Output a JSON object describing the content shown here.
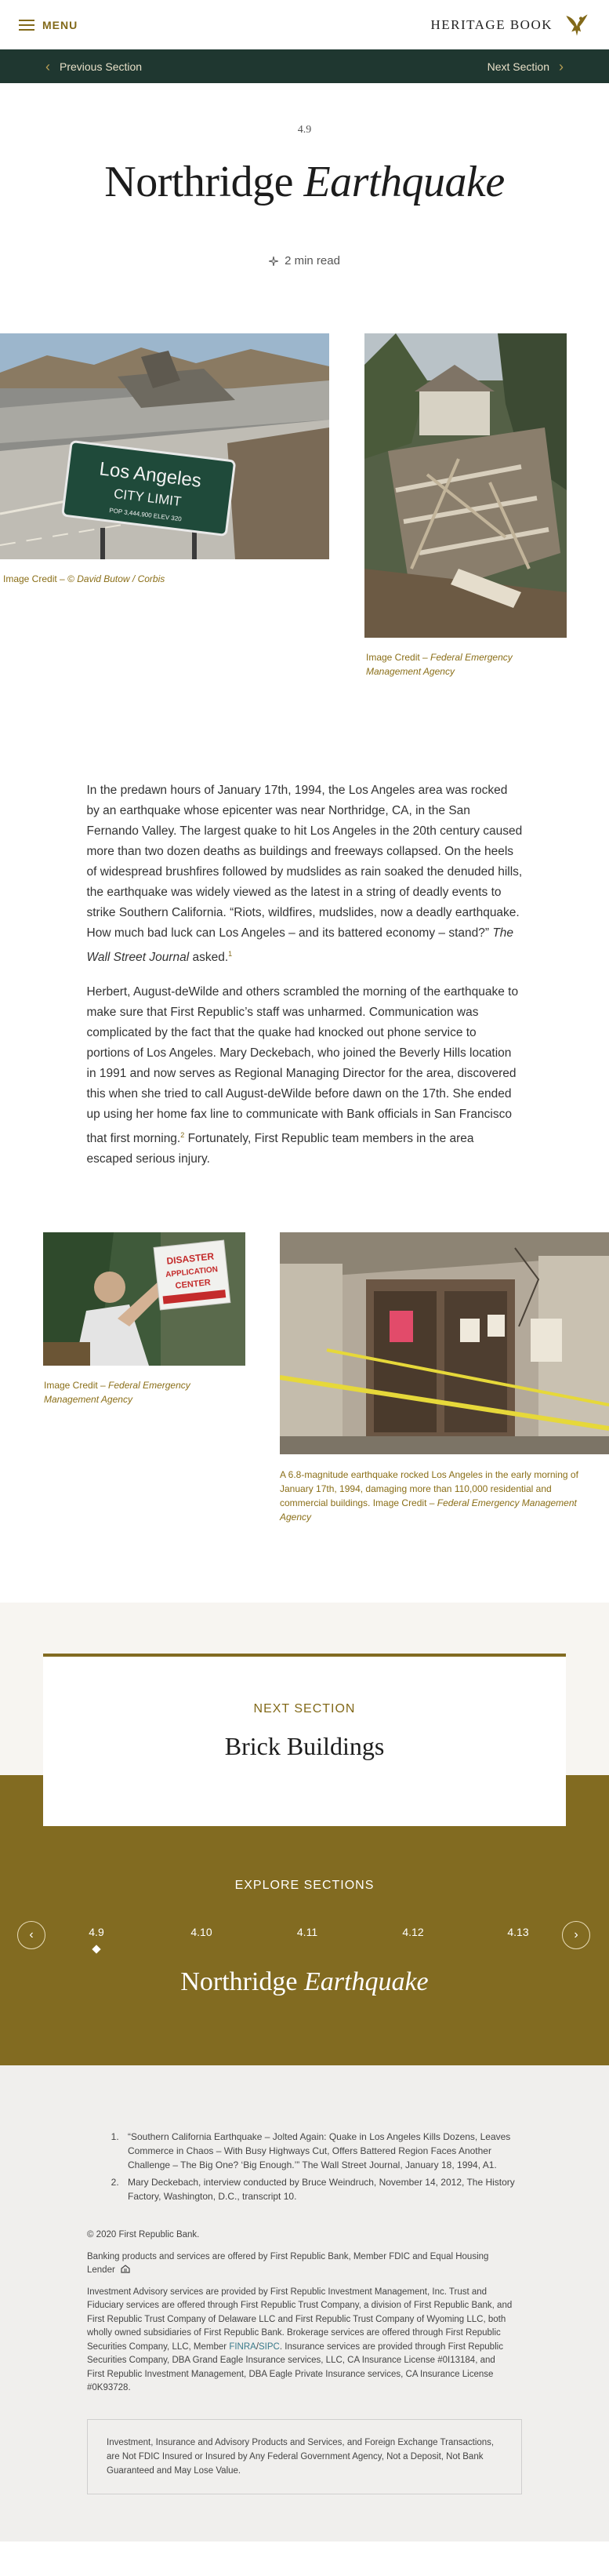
{
  "header": {
    "menu_label": "MENU",
    "brand_title": "HERITAGE BOOK",
    "logo_icon": "eagle-icon"
  },
  "section_nav": {
    "prev_label": "Previous Section",
    "next_label": "Next Section"
  },
  "hero": {
    "chapter": "4.9",
    "title_plain": "Northridge",
    "title_italic": "Earthquake",
    "read_time": "2 min read"
  },
  "photos_top": [
    {
      "caption_prefix": "Image Credit – ",
      "caption_credit": "© David Butow / Corbis",
      "sign_line1": "Los Angeles",
      "sign_line2": "CITY LIMIT",
      "sign_line3": "POP 3,444,900   ELEV 320"
    },
    {
      "caption_prefix": "Image Credit – ",
      "caption_credit": "Federal Emergency Management Agency"
    }
  ],
  "article": {
    "p1": "In the predawn hours of January 17th, 1994, the Los Angeles area was rocked by an earthquake whose epicenter was near Northridge, CA, in the San Fernando Valley. The largest quake to hit Los Angeles in the 20th century caused more than two dozen deaths as buildings and freeways collapsed. On the heels of widespread brushfires followed by mudslides as rain soaked the denuded hills, the earthquake was widely viewed as the latest in a string of deadly events to strike Southern California. “Riots, wildfires, mudslides, now a deadly earthquake. How much bad luck can Los Angeles – and its battered economy – stand?” ",
    "p1_em": "The Wall Street Journal",
    "p1_end": " asked.",
    "p1_note": "1",
    "p2": "Herbert, August-deWilde and others scrambled the morning of the earthquake to make sure that First Republic’s staff was unharmed. Communication was complicated by the fact that the quake had knocked out phone service to portions of Los Angeles. Mary Deckebach, who joined the Beverly Hills location in 1991 and now serves as Regional Managing Director for the area, discovered this when she tried to call August-deWilde before dawn on the 17th. She ended up using her home fax line to communicate with Bank officials in San Francisco that first morning.",
    "p2_note": "2",
    "p2_end": " Fortunately, First Republic team members in the area escaped serious injury."
  },
  "photos_bottom": [
    {
      "caption_prefix": "Image Credit – ",
      "caption_credit": "Federal Emergency Management Agency",
      "sign_text": "DISASTER APPLICATION CENTER"
    },
    {
      "caption_prefix": "A 6.8-magnitude earthquake rocked Los Angeles in the early morning of January 17th, 1994, damaging more than 110,000 residential and commercial buildings. Image Credit – ",
      "caption_credit": "Federal Emergency Management Agency"
    }
  ],
  "next_section": {
    "label": "NEXT SECTION",
    "title": "Brick Buildings"
  },
  "explore": {
    "label": "EXPLORE SECTIONS",
    "items": [
      "4.9",
      "4.10",
      "4.11",
      "4.12",
      "4.13"
    ],
    "active_index": 0,
    "current_plain": "Northridge",
    "current_italic": "Earthquake"
  },
  "footnotes": [
    "“Southern California Earthquake – Jolted Again: Quake in Los Angeles Kills Dozens, Leaves Commerce in Chaos – With Busy Highways Cut, Offers Battered Region Faces Another Challenge – The Big One? ‘Big Enough.’” The Wall Street Journal, January 18, 1994, A1.",
    "Mary Deckebach, interview conducted by Bruce Weindruch, November 14, 2012, The History Factory, Washington, D.C., transcript 10."
  ],
  "legal": {
    "copyright": "© 2020 First Republic Bank.",
    "banking": "Banking products and services are offered by First Republic Bank, Member FDIC and Equal Housing Lender",
    "ehl_icon": "equal-housing-icon",
    "investment_a": "Investment Advisory services are provided by First Republic Investment Management, Inc. Trust and Fiduciary services are offered through First Republic Trust Company, a division of First Republic Bank, and First Republic Trust Company of Delaware LLC and First Republic Trust Company of Wyoming LLC, both wholly owned subsidiaries of First Republic Bank. Brokerage services are offered through First Republic Securities Company, LLC, Member ",
    "finra": "FINRA",
    "slash": "/",
    "sipc": "SIPC",
    "investment_b": ". Insurance services are provided through First Republic Securities Company, DBA Grand Eagle Insurance services, LLC, CA Insurance License #0I13184, and First Republic Investment Management, DBA Eagle Private Insurance services, CA Insurance License #0K93728.",
    "disclaimer": "Investment, Insurance and Advisory Products and Services, and Foreign Exchange Transactions, are Not FDIC Insured or Insured by Any Federal Government Agency, Not a Deposit, Not Bank Guaranteed and May Lose Value."
  }
}
